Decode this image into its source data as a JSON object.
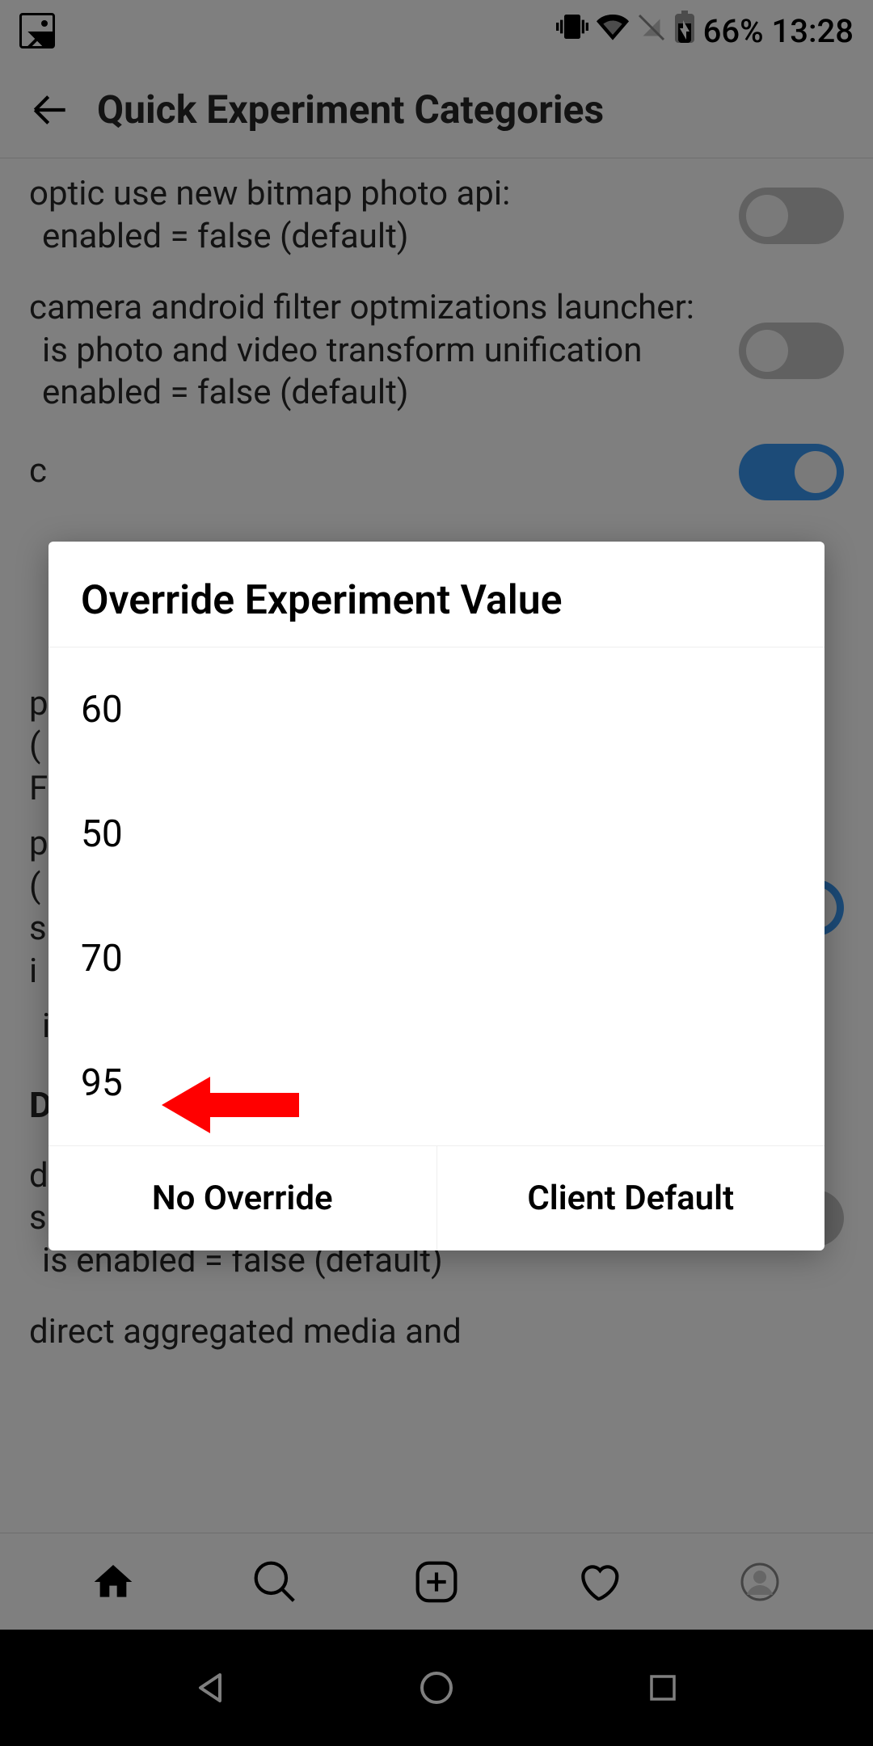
{
  "status": {
    "battery": "66%",
    "time": "13:28"
  },
  "header": {
    "title": "Quick Experiment Categories"
  },
  "experiments": {
    "item0_line1": "optic use new bitmap photo api:",
    "item0_line2": "enabled = false (default)",
    "item1_line1": "camera android filter optmizations launcher:",
    "item1_line2": "is photo and video transform unification enabled = false (default)",
    "item2_partial": "c",
    "section_c_header": "C",
    "item3_line1": "p",
    "item3_line2": "(",
    "item3_line3": "F",
    "item4_line1": "p",
    "item4_line2": "(",
    "item4_line3": "s",
    "item4_line4": "i",
    "item5_text": "is enabled = false (default)",
    "direct_section": "Direct",
    "direct_item1_line1": "direct add direct to android native photo share sheet:",
    "direct_item1_line2": "is enabled = false (default)",
    "direct_item2_line1": "direct aggregated media and"
  },
  "dialog": {
    "title": "Override Experiment Value",
    "options": {
      "opt0": "60",
      "opt1": "50",
      "opt2": "70",
      "opt3": "95"
    },
    "btn_no_override": "No Override",
    "btn_client_default": "Client Default"
  }
}
